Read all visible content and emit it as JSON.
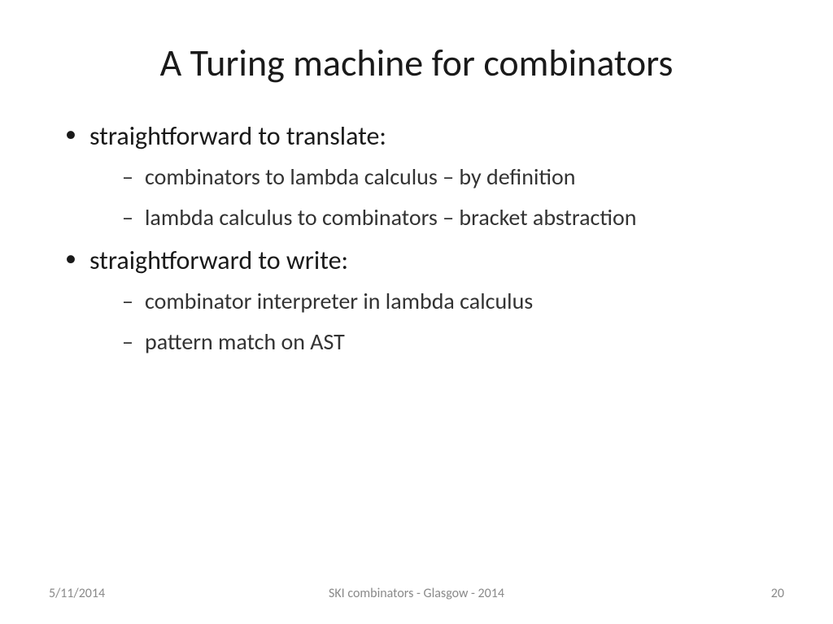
{
  "title": "A Turing machine for combinators",
  "bullets": {
    "b1": "straightforward to translate:",
    "b1_sub1": "combinators to lambda calculus – by definition",
    "b1_sub2": "lambda calculus to combinators – bracket abstraction",
    "b2": "straightforward to write:",
    "b2_sub1": "combinator interpreter in lambda calculus",
    "b2_sub2": "pattern match on AST"
  },
  "footer": {
    "date": "5/11/2014",
    "center": "SKI combinators - Glasgow - 2014",
    "page": "20"
  }
}
